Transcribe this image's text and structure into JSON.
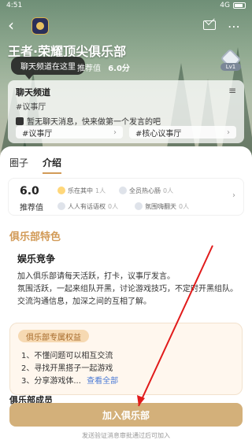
{
  "status": {
    "time": "4:51",
    "signal": "4G",
    "battery": "▮"
  },
  "header": {
    "title": "王者·荣耀顶尖俱乐部",
    "chat_bubble": "聊天频道在这里",
    "rec_label": "推荐值",
    "rec_value": "6.0分",
    "level": "Lv1"
  },
  "chat_channel": {
    "title": "聊天频道",
    "tag": "#议事厅",
    "message": "暂无聊天消息，快来做第一个发言的吧",
    "links": [
      "#议事厅",
      "#核心议事厅"
    ]
  },
  "tabs": [
    "圈子",
    "介绍"
  ],
  "stats": {
    "score": "6.0",
    "score_label": "推荐值",
    "pills": [
      {
        "label": "乐在其中",
        "count": "1人"
      },
      {
        "label": "全员热心肠",
        "count": "0人"
      },
      {
        "label": "人人有话语权",
        "count": "0人"
      },
      {
        "label": "氛围嗨翻天",
        "count": "0人"
      }
    ]
  },
  "features": {
    "section_title": "俱乐部特色",
    "card_title": "娱乐竞争",
    "lines": [
      "加入俱乐部请每天活跃，打卡，议事厅发言。",
      "氛围活跃，一起来组队开黑，讨论游戏技巧，不定时开黑组队。",
      "交流沟通信息，加深之间的互相了解。"
    ]
  },
  "benefits": {
    "title": "俱乐部专属权益",
    "items": [
      "1、不懂问题可以相互交流",
      "2、寻找开黑搭子一起游戏",
      "3、分享游戏体..."
    ],
    "see_all": "查看全部"
  },
  "members_title": "俱乐部成员",
  "footer": {
    "join_label": "加入俱乐部",
    "hint": "发送验证消息审批通过后可加入"
  },
  "colors": {
    "accent": "#d3b07a",
    "accent_text": "#d29b58",
    "annotation_red": "#e11b1b"
  }
}
